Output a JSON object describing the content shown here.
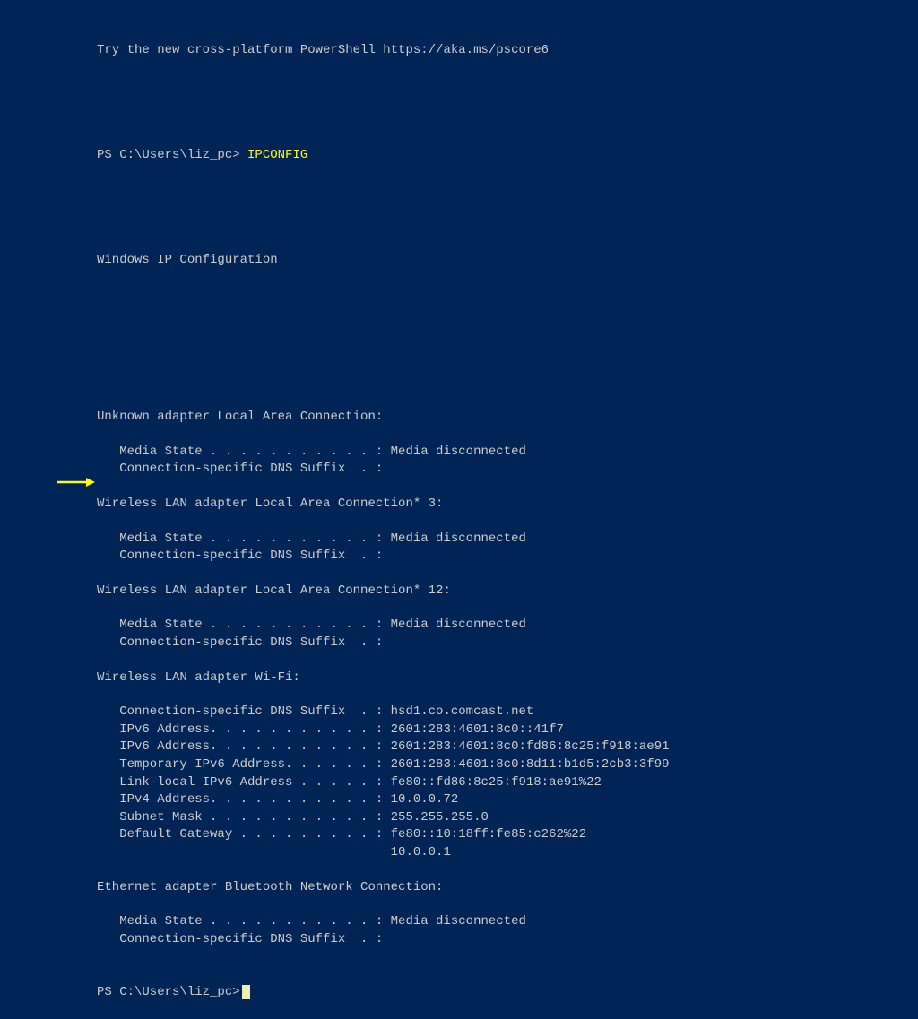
{
  "colors": {
    "background": "#012456",
    "text": "#cccccc",
    "command": "#ffff00",
    "arrow": "#ffff00"
  },
  "intro": "Try the new cross-platform PowerShell https://aka.ms/pscore6",
  "prompt1": "PS C:\\Users\\liz_pc> ",
  "command": "IPCONFIG",
  "header": "Windows IP Configuration",
  "sections": [
    {
      "title": "Unknown adapter Local Area Connection:",
      "lines": [
        {
          "label": "Media State . . . . . . . . . . . :",
          "value": " Media disconnected"
        },
        {
          "label": "Connection-specific DNS Suffix  . :",
          "value": ""
        }
      ],
      "trailing_blanks": 1
    },
    {
      "title": "Wireless LAN adapter Local Area Connection* 3:",
      "lines": [
        {
          "label": "Media State . . . . . . . . . . . :",
          "value": " Media disconnected"
        },
        {
          "label": "Connection-specific DNS Suffix  . :",
          "value": ""
        }
      ],
      "trailing_blanks": 1
    },
    {
      "title": "Wireless LAN adapter Local Area Connection* 12:",
      "lines": [
        {
          "label": "Media State . . . . . . . . . . . :",
          "value": " Media disconnected"
        },
        {
          "label": "Connection-specific DNS Suffix  . :",
          "value": ""
        }
      ],
      "trailing_blanks": 1
    },
    {
      "title": "Wireless LAN adapter Wi-Fi:",
      "lines": [
        {
          "label": "Connection-specific DNS Suffix  . :",
          "value": " hsd1.co.comcast.net"
        },
        {
          "label": "IPv6 Address. . . . . . . . . . . :",
          "value": " 2601:283:4601:8c0::41f7"
        },
        {
          "label": "IPv6 Address. . . . . . . . . . . :",
          "value": " 2601:283:4601:8c0:fd86:8c25:f918:ae91"
        },
        {
          "label": "Temporary IPv6 Address. . . . . . :",
          "value": " 2601:283:4601:8c0:8d11:b1d5:2cb3:3f99"
        },
        {
          "label": "Link-local IPv6 Address . . . . . :",
          "value": " fe80::fd86:8c25:f918:ae91%22"
        },
        {
          "label": "IPv4 Address. . . . . . . . . . . :",
          "value": " 10.0.0.72",
          "highlight": true
        },
        {
          "label": "Subnet Mask . . . . . . . . . . . :",
          "value": " 255.255.255.0"
        },
        {
          "label": "Default Gateway . . . . . . . . . :",
          "value": " fe80::10:18ff:fe85:c262%22"
        },
        {
          "label": "                                   ",
          "value": " 10.0.0.1"
        }
      ],
      "trailing_blanks": 1
    },
    {
      "title": "Ethernet adapter Bluetooth Network Connection:",
      "lines": [
        {
          "label": "Media State . . . . . . . . . . . :",
          "value": " Media disconnected"
        },
        {
          "label": "Connection-specific DNS Suffix  . :",
          "value": ""
        }
      ],
      "trailing_blanks": 0
    }
  ],
  "prompt2": "PS C:\\Users\\liz_pc>"
}
